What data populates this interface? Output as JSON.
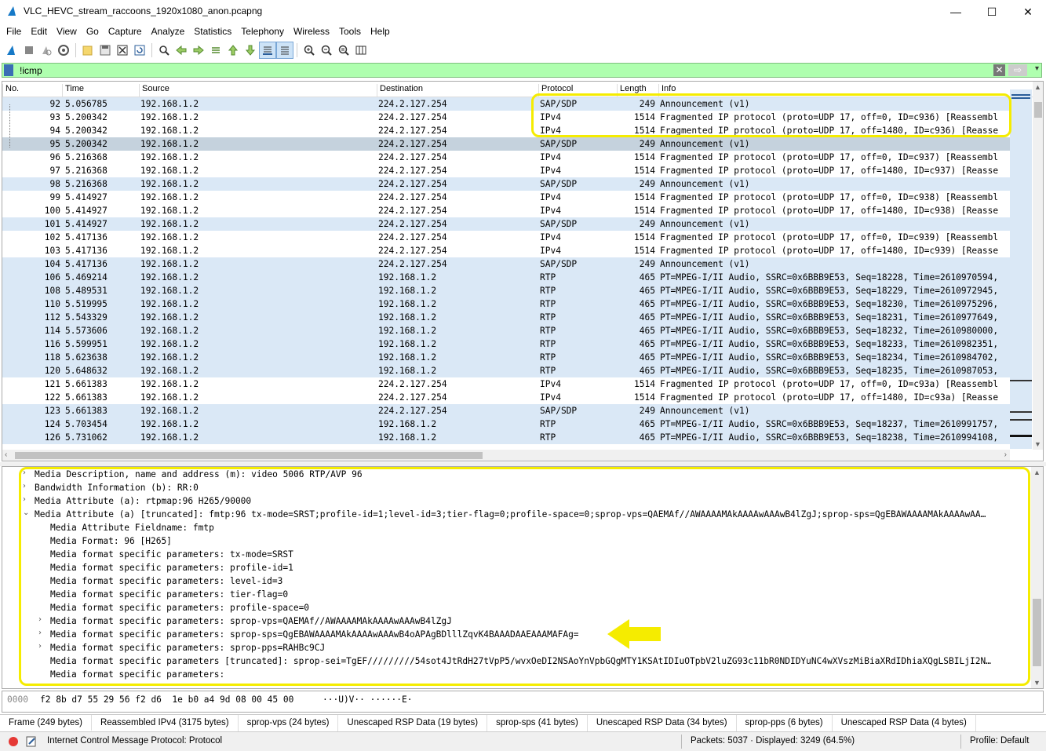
{
  "window": {
    "title": "VLC_HEVC_stream_raccoons_1920x1080_anon.pcapng",
    "minimize": "—",
    "maximize": "☐",
    "close": "✕"
  },
  "menu": [
    "File",
    "Edit",
    "View",
    "Go",
    "Capture",
    "Analyze",
    "Statistics",
    "Telephony",
    "Wireless",
    "Tools",
    "Help"
  ],
  "toolbar_icons": [
    "shark-fin-start-icon",
    "stop-icon",
    "restart-icon",
    "options-icon",
    "open-icon",
    "save-icon",
    "close-file-icon",
    "reload-icon",
    "find-icon",
    "back-icon",
    "forward-icon",
    "goto-icon",
    "first-icon",
    "last-icon",
    "autoscroll-icon",
    "colorize-icon",
    "zoom-in-icon",
    "zoom-out-icon",
    "zoom-reset-icon",
    "resize-columns-icon"
  ],
  "filter": {
    "value": "!icmp",
    "clear": "✕",
    "apply": "⇨",
    "dropdown": "▾"
  },
  "columns": [
    "No.",
    "Time",
    "Source",
    "Destination",
    "Protocol",
    "Length",
    "Info"
  ],
  "packets": [
    {
      "no": "92",
      "time": "5.056785",
      "src": "192.168.1.2",
      "dst": "224.2.127.254",
      "proto": "SAP/SDP",
      "len": "249",
      "info": "Announcement (v1)",
      "style": "sap"
    },
    {
      "no": "93",
      "time": "5.200342",
      "src": "192.168.1.2",
      "dst": "224.2.127.254",
      "proto": "IPv4",
      "len": "1514",
      "info": "Fragmented IP protocol (proto=UDP 17, off=0, ID=c936) [Reassembl",
      "style": "ipv4"
    },
    {
      "no": "94",
      "time": "5.200342",
      "src": "192.168.1.2",
      "dst": "224.2.127.254",
      "proto": "IPv4",
      "len": "1514",
      "info": "Fragmented IP protocol (proto=UDP 17, off=1480, ID=c936) [Reasse",
      "style": "ipv4"
    },
    {
      "no": "95",
      "time": "5.200342",
      "src": "192.168.1.2",
      "dst": "224.2.127.254",
      "proto": "SAP/SDP",
      "len": "249",
      "info": "Announcement (v1)",
      "style": "selected"
    },
    {
      "no": "96",
      "time": "5.216368",
      "src": "192.168.1.2",
      "dst": "224.2.127.254",
      "proto": "IPv4",
      "len": "1514",
      "info": "Fragmented IP protocol (proto=UDP 17, off=0, ID=c937) [Reassembl",
      "style": "ipv4"
    },
    {
      "no": "97",
      "time": "5.216368",
      "src": "192.168.1.2",
      "dst": "224.2.127.254",
      "proto": "IPv4",
      "len": "1514",
      "info": "Fragmented IP protocol (proto=UDP 17, off=1480, ID=c937) [Reasse",
      "style": "ipv4"
    },
    {
      "no": "98",
      "time": "5.216368",
      "src": "192.168.1.2",
      "dst": "224.2.127.254",
      "proto": "SAP/SDP",
      "len": "249",
      "info": "Announcement (v1)",
      "style": "sap"
    },
    {
      "no": "99",
      "time": "5.414927",
      "src": "192.168.1.2",
      "dst": "224.2.127.254",
      "proto": "IPv4",
      "len": "1514",
      "info": "Fragmented IP protocol (proto=UDP 17, off=0, ID=c938) [Reassembl",
      "style": "ipv4"
    },
    {
      "no": "100",
      "time": "5.414927",
      "src": "192.168.1.2",
      "dst": "224.2.127.254",
      "proto": "IPv4",
      "len": "1514",
      "info": "Fragmented IP protocol (proto=UDP 17, off=1480, ID=c938) [Reasse",
      "style": "ipv4"
    },
    {
      "no": "101",
      "time": "5.414927",
      "src": "192.168.1.2",
      "dst": "224.2.127.254",
      "proto": "SAP/SDP",
      "len": "249",
      "info": "Announcement (v1)",
      "style": "sap"
    },
    {
      "no": "102",
      "time": "5.417136",
      "src": "192.168.1.2",
      "dst": "224.2.127.254",
      "proto": "IPv4",
      "len": "1514",
      "info": "Fragmented IP protocol (proto=UDP 17, off=0, ID=c939) [Reassembl",
      "style": "ipv4"
    },
    {
      "no": "103",
      "time": "5.417136",
      "src": "192.168.1.2",
      "dst": "224.2.127.254",
      "proto": "IPv4",
      "len": "1514",
      "info": "Fragmented IP protocol (proto=UDP 17, off=1480, ID=c939) [Reasse",
      "style": "ipv4"
    },
    {
      "no": "104",
      "time": "5.417136",
      "src": "192.168.1.2",
      "dst": "224.2.127.254",
      "proto": "SAP/SDP",
      "len": "249",
      "info": "Announcement (v1)",
      "style": "sap"
    },
    {
      "no": "106",
      "time": "5.469214",
      "src": "192.168.1.2",
      "dst": "192.168.1.2",
      "proto": "RTP",
      "len": "465",
      "info": "PT=MPEG-I/II Audio, SSRC=0x6BBB9E53, Seq=18228, Time=2610970594,",
      "style": "rtp"
    },
    {
      "no": "108",
      "time": "5.489531",
      "src": "192.168.1.2",
      "dst": "192.168.1.2",
      "proto": "RTP",
      "len": "465",
      "info": "PT=MPEG-I/II Audio, SSRC=0x6BBB9E53, Seq=18229, Time=2610972945,",
      "style": "rtp"
    },
    {
      "no": "110",
      "time": "5.519995",
      "src": "192.168.1.2",
      "dst": "192.168.1.2",
      "proto": "RTP",
      "len": "465",
      "info": "PT=MPEG-I/II Audio, SSRC=0x6BBB9E53, Seq=18230, Time=2610975296,",
      "style": "rtp"
    },
    {
      "no": "112",
      "time": "5.543329",
      "src": "192.168.1.2",
      "dst": "192.168.1.2",
      "proto": "RTP",
      "len": "465",
      "info": "PT=MPEG-I/II Audio, SSRC=0x6BBB9E53, Seq=18231, Time=2610977649,",
      "style": "rtp"
    },
    {
      "no": "114",
      "time": "5.573606",
      "src": "192.168.1.2",
      "dst": "192.168.1.2",
      "proto": "RTP",
      "len": "465",
      "info": "PT=MPEG-I/II Audio, SSRC=0x6BBB9E53, Seq=18232, Time=2610980000,",
      "style": "rtp"
    },
    {
      "no": "116",
      "time": "5.599951",
      "src": "192.168.1.2",
      "dst": "192.168.1.2",
      "proto": "RTP",
      "len": "465",
      "info": "PT=MPEG-I/II Audio, SSRC=0x6BBB9E53, Seq=18233, Time=2610982351,",
      "style": "rtp"
    },
    {
      "no": "118",
      "time": "5.623638",
      "src": "192.168.1.2",
      "dst": "192.168.1.2",
      "proto": "RTP",
      "len": "465",
      "info": "PT=MPEG-I/II Audio, SSRC=0x6BBB9E53, Seq=18234, Time=2610984702,",
      "style": "rtp"
    },
    {
      "no": "120",
      "time": "5.648632",
      "src": "192.168.1.2",
      "dst": "192.168.1.2",
      "proto": "RTP",
      "len": "465",
      "info": "PT=MPEG-I/II Audio, SSRC=0x6BBB9E53, Seq=18235, Time=2610987053,",
      "style": "rtp"
    },
    {
      "no": "121",
      "time": "5.661383",
      "src": "192.168.1.2",
      "dst": "224.2.127.254",
      "proto": "IPv4",
      "len": "1514",
      "info": "Fragmented IP protocol (proto=UDP 17, off=0, ID=c93a) [Reassembl",
      "style": "ipv4"
    },
    {
      "no": "122",
      "time": "5.661383",
      "src": "192.168.1.2",
      "dst": "224.2.127.254",
      "proto": "IPv4",
      "len": "1514",
      "info": "Fragmented IP protocol (proto=UDP 17, off=1480, ID=c93a) [Reasse",
      "style": "ipv4"
    },
    {
      "no": "123",
      "time": "5.661383",
      "src": "192.168.1.2",
      "dst": "224.2.127.254",
      "proto": "SAP/SDP",
      "len": "249",
      "info": "Announcement (v1)",
      "style": "sap"
    },
    {
      "no": "124",
      "time": "5.703454",
      "src": "192.168.1.2",
      "dst": "192.168.1.2",
      "proto": "RTP",
      "len": "465",
      "info": "PT=MPEG-I/II Audio, SSRC=0x6BBB9E53, Seq=18237, Time=2610991757,",
      "style": "rtp"
    },
    {
      "no": "126",
      "time": "5.731062",
      "src": "192.168.1.2",
      "dst": "192.168.1.2",
      "proto": "RTP",
      "len": "465",
      "info": "PT=MPEG-I/II Audio, SSRC=0x6BBB9E53, Seq=18238, Time=2610994108,",
      "style": "rtp"
    }
  ],
  "details": [
    {
      "indent": 0,
      "arrow": "›",
      "text": "Media Description, name and address (m): video 5006 RTP/AVP 96"
    },
    {
      "indent": 0,
      "arrow": "›",
      "text": "Bandwidth Information (b): RR:0"
    },
    {
      "indent": 0,
      "arrow": "›",
      "text": "Media Attribute (a): rtpmap:96 H265/90000"
    },
    {
      "indent": 0,
      "arrow": "⌄",
      "text": "Media Attribute (a) [truncated]: fmtp:96 tx-mode=SRST;profile-id=1;level-id=3;tier-flag=0;profile-space=0;sprop-vps=QAEMAf//AWAAAAMAkAAAAwAAAwB4lZgJ;sprop-sps=QgEBAWAAAAMAkAAAAwAA…"
    },
    {
      "indent": 1,
      "arrow": "",
      "text": "Media Attribute Fieldname: fmtp"
    },
    {
      "indent": 1,
      "arrow": "",
      "text": "Media Format: 96 [H265]"
    },
    {
      "indent": 1,
      "arrow": "",
      "text": "Media format specific parameters: tx-mode=SRST"
    },
    {
      "indent": 1,
      "arrow": "",
      "text": "Media format specific parameters: profile-id=1"
    },
    {
      "indent": 1,
      "arrow": "",
      "text": "Media format specific parameters: level-id=3"
    },
    {
      "indent": 1,
      "arrow": "",
      "text": "Media format specific parameters: tier-flag=0"
    },
    {
      "indent": 1,
      "arrow": "",
      "text": "Media format specific parameters: profile-space=0"
    },
    {
      "indent": 1,
      "arrow": "›",
      "text": "Media format specific parameters: sprop-vps=QAEMAf//AWAAAAMAkAAAAwAAAwB4lZgJ"
    },
    {
      "indent": 1,
      "arrow": "›",
      "text": "Media format specific parameters: sprop-sps=QgEBAWAAAAMAkAAAAwAAAwB4oAPAgBDlllZqvK4BAAADAAEAAAMAFAg="
    },
    {
      "indent": 1,
      "arrow": "›",
      "text": "Media format specific parameters: sprop-pps=RAHBc9CJ"
    },
    {
      "indent": 1,
      "arrow": "",
      "text": "Media format specific parameters [truncated]: sprop-sei=TgEF/////////54sot4JtRdH27tVpP5/wvxOeDI2NSAoYnVpbGQgMTY1KSAtIDIuOTpbV2luZG93c11bR0NDIDYuNC4wXVszMiBiaXRdIDhiaXQgLSBILjI2N…"
    },
    {
      "indent": 1,
      "arrow": "",
      "text": "Media format specific parameters:"
    }
  ],
  "hex": {
    "offset": "0000",
    "bytes": "f2 8b d7 55 29 56 f2 d6  1e b0 a4 9d 08 00 45 00",
    "ascii": "···U)V·· ······E·"
  },
  "tabs": [
    "Frame (249 bytes)",
    "Reassembled IPv4 (3175 bytes)",
    "sprop-vps (24 bytes)",
    "Unescaped RSP Data (19 bytes)",
    "sprop-sps (41 bytes)",
    "Unescaped RSP Data (34 bytes)",
    "sprop-pps (6 bytes)",
    "Unescaped RSP Data (4 bytes)"
  ],
  "status": {
    "field": "Internet Control Message Protocol: Protocol",
    "packets": "Packets: 5037 · Displayed: 3249 (64.5%)",
    "profile": "Profile: Default"
  },
  "colors": {
    "rtp_row": "#dae8f6",
    "sap_row": "#dae8f6",
    "ipv4_row": "#ffffff",
    "selected_row": "#c5d2dd",
    "highlight": "#f5ec00",
    "filter_ok": "#afffaf"
  }
}
